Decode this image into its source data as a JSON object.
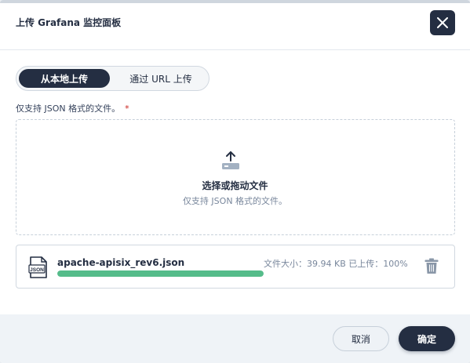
{
  "dialog": {
    "title": "上传 Grafana 监控面板",
    "close_icon": "close-icon"
  },
  "tabs": [
    {
      "label": "从本地上传",
      "active": true
    },
    {
      "label": "通过 URL 上传",
      "active": false
    }
  ],
  "field": {
    "hint": "仅支持 JSON 格式的文件。",
    "required_mark": "*"
  },
  "dropzone": {
    "icon": "upload-icon",
    "title": "选择或拖动文件",
    "subtitle": "仅支持 JSON 格式的文件。"
  },
  "file": {
    "icon": "json-file-icon",
    "icon_text": "JSON",
    "name": "apache-apisix_rev6.json",
    "meta": "文件大小：39.94 KB  已上传：100%",
    "progress": 1.0,
    "delete_icon": "trash-icon"
  },
  "footer": {
    "cancel_label": "取消",
    "ok_label": "确定"
  },
  "colors": {
    "primary": "#242e42",
    "progress": "#55bc8a",
    "required": "#ca2621"
  }
}
